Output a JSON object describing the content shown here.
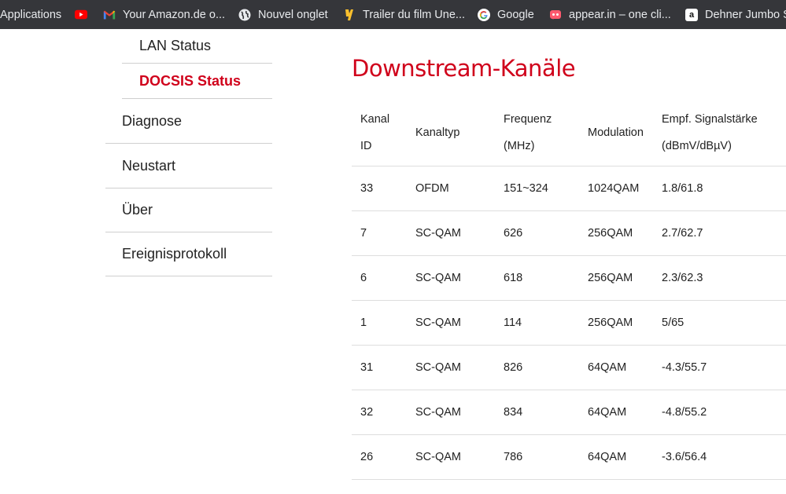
{
  "bookmarks": [
    {
      "label": "Applications",
      "icon": "apps-grid-icon"
    },
    {
      "label": "",
      "icon": "youtube-icon"
    },
    {
      "label": "Your Amazon.de o...",
      "icon": "gmail-icon"
    },
    {
      "label": "Nouvel onglet",
      "icon": "globe-icon"
    },
    {
      "label": "Trailer du film Une...",
      "icon": "film-icon"
    },
    {
      "label": "Google",
      "icon": "google-icon"
    },
    {
      "label": "appear.in – one cli...",
      "icon": "appear-icon"
    },
    {
      "label": "Dehner Jumbo S",
      "icon": "amazon-icon"
    }
  ],
  "sidebar": {
    "sub_items": [
      {
        "label": "LAN Status",
        "active": false
      },
      {
        "label": "DOCSIS Status",
        "active": true
      }
    ],
    "items": [
      {
        "label": "Diagnose"
      },
      {
        "label": "Neustart"
      },
      {
        "label": "Über"
      },
      {
        "label": "Ereignisprotokoll"
      }
    ]
  },
  "main": {
    "title": "Downstream-Kanäle",
    "table": {
      "headers": [
        {
          "line1": "Kanal",
          "line2": "ID"
        },
        {
          "line1": "Kanaltyp",
          "line2": ""
        },
        {
          "line1": "Frequenz",
          "line2": "(MHz)"
        },
        {
          "line1": "Modulation",
          "line2": ""
        },
        {
          "line1": "Empf. Signalstärke",
          "line2": "(dBmV/dBµV)"
        }
      ],
      "rows": [
        [
          "33",
          "OFDM",
          "151~324",
          "1024QAM",
          "1.8/61.8"
        ],
        [
          "7",
          "SC-QAM",
          "626",
          "256QAM",
          "2.7/62.7"
        ],
        [
          "6",
          "SC-QAM",
          "618",
          "256QAM",
          "2.3/62.3"
        ],
        [
          "1",
          "SC-QAM",
          "114",
          "256QAM",
          "5/65"
        ],
        [
          "31",
          "SC-QAM",
          "826",
          "64QAM",
          "-4.3/55.7"
        ],
        [
          "32",
          "SC-QAM",
          "834",
          "64QAM",
          "-4.8/55.2"
        ],
        [
          "26",
          "SC-QAM",
          "786",
          "64QAM",
          "-3.6/56.4"
        ]
      ]
    }
  },
  "colors": {
    "accent": "#d0021b",
    "bookmarks_bg": "#35363a",
    "divider": "#cfcfcf"
  }
}
